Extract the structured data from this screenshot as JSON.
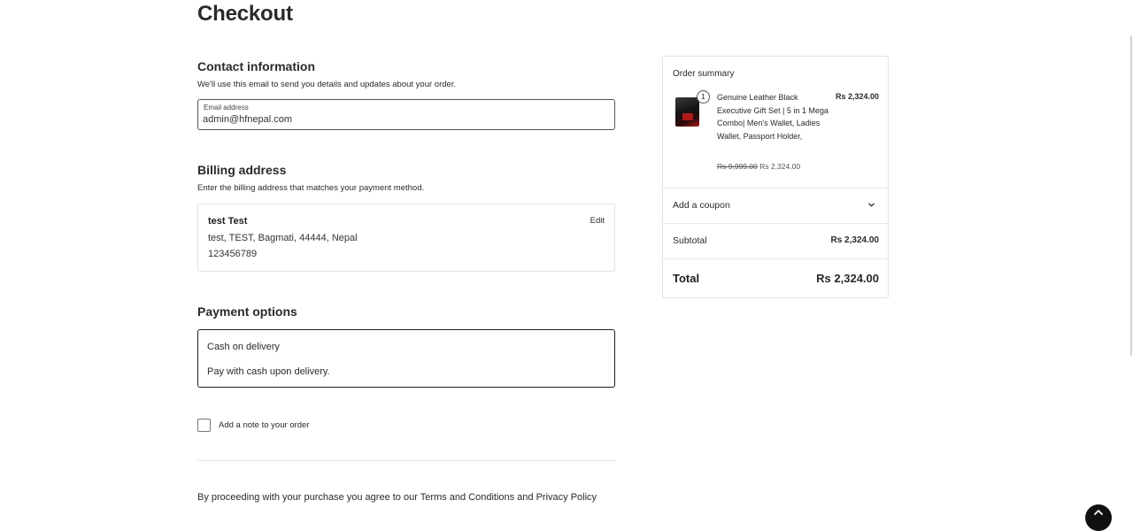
{
  "page": {
    "title": "Checkout"
  },
  "contact": {
    "title": "Contact information",
    "description": "We'll use this email to send you details and updates about your order.",
    "email_label": "Email address",
    "email_value": "admin@hfnepal.com"
  },
  "billing": {
    "title": "Billing address",
    "description": "Enter the billing address that matches your payment method.",
    "name": "test Test",
    "address_line": "test, TEST, Bagmati, 44444, Nepal",
    "phone": "123456789",
    "edit_label": "Edit"
  },
  "payment": {
    "title": "Payment options",
    "method_name": "Cash on delivery",
    "method_description": "Pay with cash upon delivery."
  },
  "note": {
    "label": "Add a note to your order",
    "checked": false
  },
  "terms": {
    "prefix": "By proceeding with your purchase you agree to our ",
    "terms_link": "Terms and Conditions",
    "and": " and ",
    "privacy_link": "Privacy Policy"
  },
  "summary": {
    "title": "Order summary",
    "item": {
      "quantity": "1",
      "name": "Genuine Leather Black Executive Gift Set | 5 in 1 Mega Combo| Men's Wallet, Ladies Wallet, Passport Holder,",
      "line_total": "Rs 2,324.00",
      "regular_price": "Rs 9,999.00",
      "sale_price": "Rs 2,324.00"
    },
    "coupon_label": "Add a coupon",
    "subtotal_label": "Subtotal",
    "subtotal_value": "Rs 2,324.00",
    "total_label": "Total",
    "total_value": "Rs 2,324.00"
  },
  "icons": {
    "coupon_toggle": "chevron-down-icon",
    "fab": "arrow-up-icon"
  },
  "colors": {
    "text": "#2a2a2a",
    "border": "#e4e4e4",
    "active_border": "#1e1e1e",
    "fab": "#111111"
  }
}
